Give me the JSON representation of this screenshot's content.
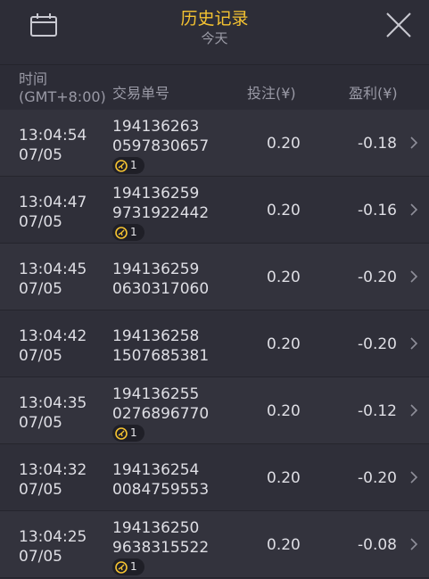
{
  "header": {
    "title": "历史记录",
    "subtitle": "今天",
    "calendar_icon": "calendar-icon",
    "close_icon": "close-icon"
  },
  "columns": {
    "time": "时间",
    "timezone": "(GMT+8:00)",
    "order_id": "交易单号",
    "bet": "投注(¥)",
    "profit": "盈利(¥)"
  },
  "colors": {
    "accent": "#f5c331",
    "background": "#2b2b35"
  },
  "rows": [
    {
      "time": "13:04:54",
      "date": "07/05",
      "id1": "194136263",
      "id2": "0597830657",
      "badge": "1",
      "bet": "0.20",
      "profit": "-0.18"
    },
    {
      "time": "13:04:47",
      "date": "07/05",
      "id1": "194136259",
      "id2": "9731922442",
      "badge": "1",
      "bet": "0.20",
      "profit": "-0.16"
    },
    {
      "time": "13:04:45",
      "date": "07/05",
      "id1": "194136259",
      "id2": "0630317060",
      "badge": null,
      "bet": "0.20",
      "profit": "-0.20"
    },
    {
      "time": "13:04:42",
      "date": "07/05",
      "id1": "194136258",
      "id2": "1507685381",
      "badge": null,
      "bet": "0.20",
      "profit": "-0.20"
    },
    {
      "time": "13:04:35",
      "date": "07/05",
      "id1": "194136255",
      "id2": "0276896770",
      "badge": "1",
      "bet": "0.20",
      "profit": "-0.12"
    },
    {
      "time": "13:04:32",
      "date": "07/05",
      "id1": "194136254",
      "id2": "0084759553",
      "badge": null,
      "bet": "0.20",
      "profit": "-0.20"
    },
    {
      "time": "13:04:25",
      "date": "07/05",
      "id1": "194136250",
      "id2": "9638315522",
      "badge": "1",
      "bet": "0.20",
      "profit": "-0.08"
    }
  ]
}
